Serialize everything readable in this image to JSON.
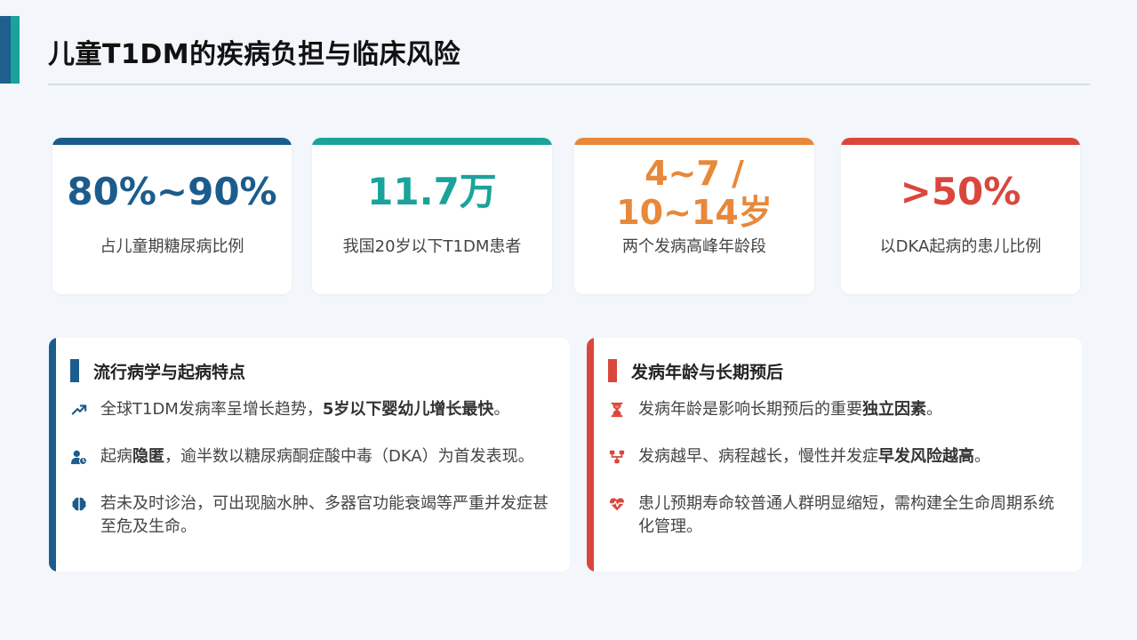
{
  "header": {
    "title": "儿童T1DM的疾病负担与临床风险"
  },
  "stats": [
    {
      "value": "80%~90%",
      "label": "占儿童期糖尿病比例",
      "color": "#1c5c8c"
    },
    {
      "value": "11.7万",
      "label": "我国20岁以下T1DM患者",
      "color": "#1aa39a"
    },
    {
      "value": "4~7 / 10~14岁",
      "label": "两个发病高峰年龄段",
      "color": "#e8883a"
    },
    {
      "value": ">50%",
      "label": "以DKA起病的患儿比例",
      "color": "#d9473c"
    }
  ],
  "left_panel": {
    "heading": "流行病学与起病特点",
    "accent": "#1c5c8c",
    "items": [
      {
        "icon": "trend-up-icon",
        "pre": "全球T1DM发病率呈增长趋势，",
        "bold": "5岁以下婴幼儿增长最快",
        "post": "。"
      },
      {
        "icon": "user-clock-icon",
        "pre": "起病",
        "bold": "隐匿",
        "post": "，逾半数以糖尿病酮症酸中毒（DKA）为首发表现。"
      },
      {
        "icon": "brain-icon",
        "pre": "若未及时诊治，可出现脑水肿、多器官功能衰竭等严重并发症甚至危及生命。",
        "bold": "",
        "post": ""
      }
    ]
  },
  "right_panel": {
    "heading": "发病年龄与长期预后",
    "accent": "#d9473c",
    "items": [
      {
        "icon": "hourglass-icon",
        "pre": "发病年龄是影响长期预后的重要",
        "bold": "独立因素",
        "post": "。"
      },
      {
        "icon": "branch-icon",
        "pre": "发病越早、病程越长，慢性并发症",
        "bold": "早发风险越高",
        "post": "。"
      },
      {
        "icon": "heart-pulse-icon",
        "pre": "患儿预期寿命较普通人群明显缩短，需构建全生命周期系统化管理。",
        "bold": "",
        "post": ""
      }
    ]
  }
}
